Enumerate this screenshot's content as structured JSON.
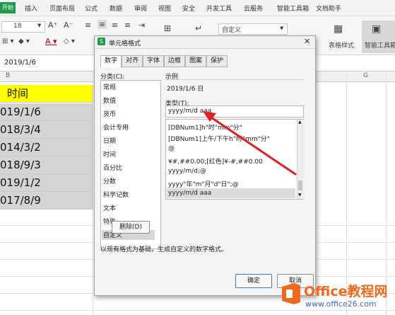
{
  "menubar": {
    "start": "开始",
    "items": [
      "插入",
      "页面布局",
      "公式",
      "数据",
      "审阅",
      "视图",
      "安全",
      "开发工具",
      "云服务",
      "智能工具箱",
      "文档助手"
    ]
  },
  "ribbon": {
    "font_size": "18",
    "number_format": "自定义",
    "table_style": "表格样式",
    "smart_toolbox": "智能工具箱"
  },
  "formula_bar": {
    "name_box": "",
    "value": "2019/1/6"
  },
  "column_headers": [
    "B",
    "G"
  ],
  "sheet": {
    "header": "时间",
    "rows": [
      "019/1/6",
      "018/3/4",
      "014/3/2",
      "018/9/3",
      "019/1/2",
      "017/8/9"
    ]
  },
  "dialog": {
    "title": "单元格格式",
    "tabs": [
      "数字",
      "对齐",
      "字体",
      "边框",
      "图案",
      "保护"
    ],
    "category_label": "分类(C):",
    "categories": [
      "常规",
      "数值",
      "货币",
      "会计专用",
      "日期",
      "时间",
      "百分比",
      "分数",
      "科学记数",
      "文本",
      "特殊",
      "自定义"
    ],
    "sample_label": "示例",
    "sample_value": "2019/1/6 日",
    "type_label": "类型(T):",
    "type_value": "yyyy/m/d aaa",
    "formats": [
      "[DBNum1]h\"时\"mm\"分\"",
      "[DBNum1]上午/下午h\"时\"mm\"分\"",
      "@",
      "¥#,##0.00;[红色]¥-#,##0.00",
      "yyyy/m/d;@",
      "yyyy\"年\"m\"月\"d\"日\";@",
      "yyyy/m/d aaa"
    ],
    "delete_button": "删除(D)",
    "description": "以现有格式为基础，生成自定义的数字格式。",
    "ok_button": "确定",
    "cancel_button": "取消"
  },
  "watermark": {
    "brand": "Office教程网",
    "url": "www.office26.com"
  },
  "colors": {
    "accent_green": "#1e9a4a",
    "header_yellow": "#ffff00",
    "arrow_red": "#e02020",
    "watermark_orange": "#f06a1d"
  }
}
